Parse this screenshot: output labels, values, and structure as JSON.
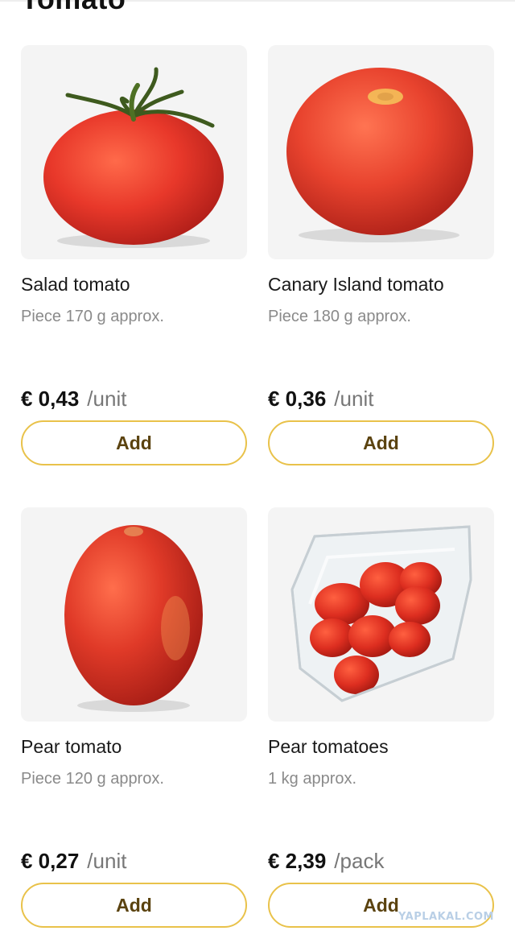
{
  "category": {
    "title": "Tomato"
  },
  "products": [
    {
      "name": "Salad tomato",
      "detail": "Piece 170 g approx.",
      "price": "€ 0,43",
      "unit": "/unit",
      "add_label": "Add"
    },
    {
      "name": "Canary Island tomato",
      "detail": "Piece 180 g approx.",
      "price": "€ 0,36",
      "unit": "/unit",
      "add_label": "Add"
    },
    {
      "name": "Pear tomato",
      "detail": "Piece 120 g approx.",
      "price": "€ 0,27",
      "unit": "/unit",
      "add_label": "Add"
    },
    {
      "name": "Pear tomatoes",
      "detail": "1 kg approx.",
      "price": "€ 2,39",
      "unit": "/pack",
      "add_label": "Add"
    }
  ],
  "watermark": "YAPLAKAL.COM",
  "colors": {
    "button_border": "#e9c24a",
    "button_text": "#5b4310",
    "image_bg": "#f4f4f4",
    "tomato_red": "#e8382a"
  }
}
